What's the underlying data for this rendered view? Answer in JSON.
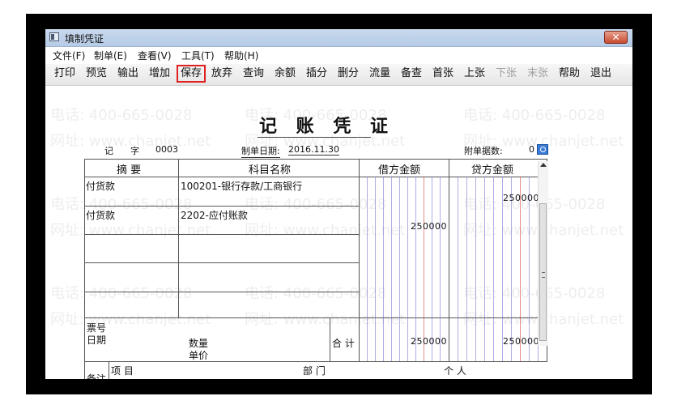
{
  "window": {
    "title": "填制凭证",
    "close_label": "✕"
  },
  "menu": [
    "文件(F)",
    "制单(E)",
    "查看(V)",
    "工具(T)",
    "帮助(H)"
  ],
  "toolbar": {
    "items": [
      "打印",
      "预览",
      "输出",
      "增加",
      "保存",
      "放弃",
      "查询",
      "余额",
      "插分",
      "删分",
      "流量",
      "备查",
      "首张",
      "上张",
      "下张",
      "末张",
      "帮助",
      "退出"
    ],
    "highlighted": "保存",
    "disabled": [
      "下张",
      "末张"
    ]
  },
  "voucher": {
    "title": "记 账 凭 证",
    "type_label": "记",
    "type_label2": "字",
    "number": "0003",
    "date_label": "制单日期:",
    "date": "2016.11.30",
    "attach_label": "附单据数:",
    "attach_count": "0",
    "columns": {
      "summary": "摘 要",
      "account": "科目名称",
      "debit": "借方金额",
      "credit": "贷方金额"
    },
    "rows": [
      {
        "summary": "付货款",
        "account": "100201-银行存款/工商银行",
        "debit": "",
        "credit": "250000"
      },
      {
        "summary": "付货款",
        "account": "2202-应付账款",
        "debit": "250000",
        "credit": ""
      }
    ],
    "footer": {
      "ticket_label": "票号",
      "date_label": "日期",
      "qty_label": "数量",
      "price_label": "单价",
      "total_label": "合 计",
      "debit_total": "250000",
      "credit_total": "250000"
    },
    "remarks": {
      "label": "备注",
      "item_label": "项 目",
      "dept_label": "部 门",
      "person_label": "个 人"
    }
  },
  "watermarks": {
    "phone": "电话: 400-665-0028",
    "url": "网址: www.chanjet.net"
  },
  "colors": {
    "highlight_border": "#e02020",
    "grid_blue": "#6c6cd0",
    "grid_red": "#d03030"
  }
}
